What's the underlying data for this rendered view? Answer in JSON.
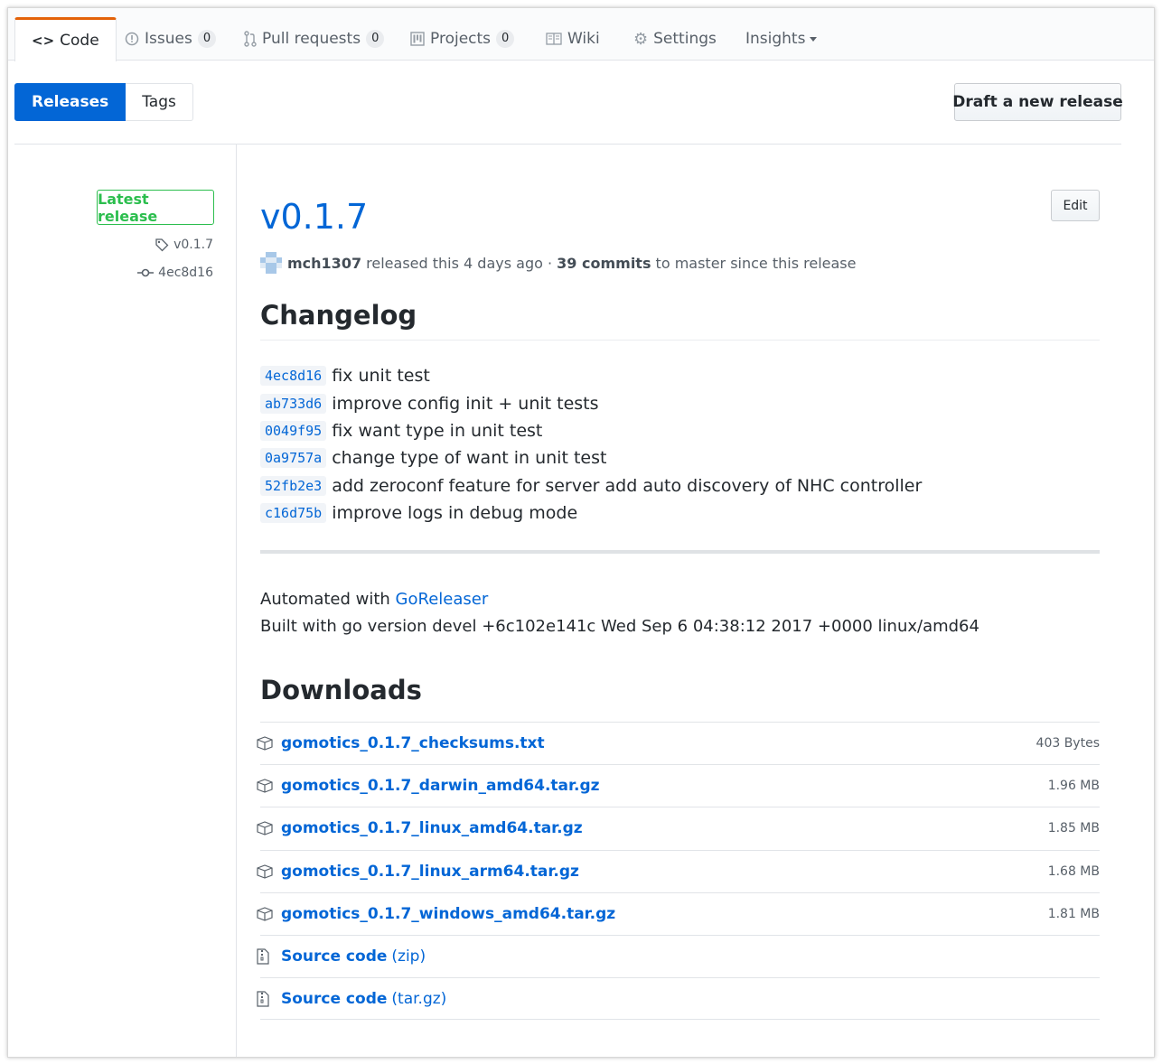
{
  "tabs": [
    {
      "label": "Code",
      "icon": "code-icon",
      "selected": true
    },
    {
      "label": "Issues",
      "icon": "issue-icon",
      "count": "0"
    },
    {
      "label": "Pull requests",
      "icon": "pull-request-icon",
      "count": "0"
    },
    {
      "label": "Projects",
      "icon": "project-icon",
      "count": "0"
    },
    {
      "label": "Wiki",
      "icon": "book-icon"
    },
    {
      "label": "Settings",
      "icon": "gear-icon"
    },
    {
      "label": "Insights",
      "icon": "chevron-down-icon"
    }
  ],
  "subnav": {
    "releases": "Releases",
    "tags": "Tags"
  },
  "actions": {
    "draft": "Draft a new release",
    "edit": "Edit"
  },
  "sidebar": {
    "latest": "Latest release",
    "tag": "v0.1.7",
    "commit": "4ec8d16"
  },
  "release": {
    "title": "v0.1.7",
    "author": "mch1307",
    "released_text": " released this 4 days ago · ",
    "commits_count": "39 commits",
    "commits_suffix": " to master since this release"
  },
  "changelog": {
    "heading": "Changelog",
    "items": [
      {
        "sha": "4ec8d16",
        "message": "fix unit test"
      },
      {
        "sha": "ab733d6",
        "message": "improve config init + unit tests"
      },
      {
        "sha": "0049f95",
        "message": "fix want type in unit test"
      },
      {
        "sha": "0a9757a",
        "message": "change type of want in unit test"
      },
      {
        "sha": "52fb2e3",
        "message": "add zeroconf feature for server add auto discovery of NHC controller"
      },
      {
        "sha": "c16d75b",
        "message": "improve logs in debug mode"
      }
    ]
  },
  "automated": {
    "prefix": "Automated with ",
    "link": "GoReleaser",
    "built": "Built with go version devel +6c102e141c Wed Sep 6 04:38:12 2017 +0000 linux/amd64"
  },
  "downloads": {
    "heading": "Downloads",
    "assets": [
      {
        "name": "gomotics_0.1.7_checksums.txt",
        "size": "403 Bytes"
      },
      {
        "name": "gomotics_0.1.7_darwin_amd64.tar.gz",
        "size": "1.96 MB"
      },
      {
        "name": "gomotics_0.1.7_linux_amd64.tar.gz",
        "size": "1.85 MB"
      },
      {
        "name": "gomotics_0.1.7_linux_arm64.tar.gz",
        "size": "1.68 MB"
      },
      {
        "name": "gomotics_0.1.7_windows_amd64.tar.gz",
        "size": "1.81 MB"
      }
    ],
    "source": [
      {
        "name": "Source code",
        "suffix": "(zip)"
      },
      {
        "name": "Source code",
        "suffix": "(tar.gz)"
      }
    ]
  },
  "colors": {
    "accent": "#0366d6",
    "tab_highlight": "#e36209",
    "latest_green": "#2cbe4e"
  }
}
